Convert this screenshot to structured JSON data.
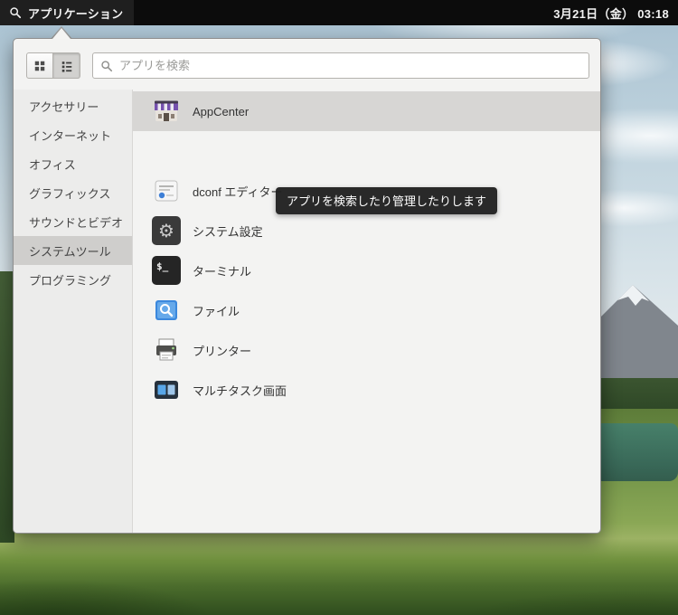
{
  "topbar": {
    "applications_label": "アプリケーション",
    "clock": "3月21日（金） 03:18"
  },
  "popup": {
    "search_placeholder": "アプリを検索",
    "tooltip": "アプリを検索したり管理したりします",
    "categories": [
      {
        "label": "アクセサリー",
        "selected": false
      },
      {
        "label": "インターネット",
        "selected": false
      },
      {
        "label": "オフィス",
        "selected": false
      },
      {
        "label": "グラフィックス",
        "selected": false
      },
      {
        "label": "サウンドとビデオ",
        "selected": false
      },
      {
        "label": "システムツール",
        "selected": true
      },
      {
        "label": "プログラミング",
        "selected": false
      }
    ],
    "apps": [
      {
        "label": "AppCenter",
        "icon": "appcenter-icon",
        "selected": true
      },
      {
        "label": "",
        "icon": "obscured-app-icon",
        "selected": false
      },
      {
        "label": "dconf エディター",
        "icon": "dconf-editor-icon",
        "selected": false
      },
      {
        "label": "システム設定",
        "icon": "system-settings-icon",
        "selected": false
      },
      {
        "label": "ターミナル",
        "icon": "terminal-icon",
        "selected": false
      },
      {
        "label": "ファイル",
        "icon": "files-icon",
        "selected": false
      },
      {
        "label": "プリンター",
        "icon": "printer-icon",
        "selected": false
      },
      {
        "label": "マルチタスク画面",
        "icon": "multitasking-icon",
        "selected": false
      }
    ]
  },
  "icons": {
    "terminal_glyph": "$_",
    "gear_glyph": "⚙"
  },
  "colors": {
    "topbar_bg": "#0c0c0c",
    "popup_bg": "#f3f3f2",
    "selection_bg": "#d7d6d4",
    "tooltip_bg": "#202020",
    "files_blue": "#3b88dd",
    "appcenter_purple": "#7550ae"
  }
}
